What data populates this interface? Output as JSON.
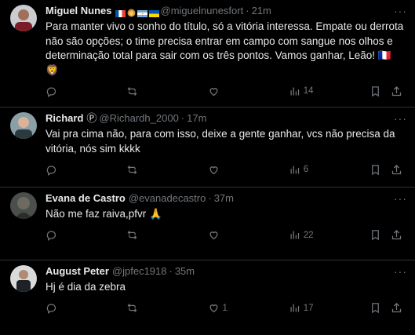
{
  "tweets": [
    {
      "name": "Miguel Nunes",
      "handle": "@miguelnunesfort",
      "time": "21m",
      "text": "Para manter vivo o sonho do título, só a vitória interessa. Empate ou derrota não são opções; o time precisa entrar em campo com sangue nos olhos e determinação total para sair com os três pontos. Vamos ganhar, Leão! 🇫🇷 🦁",
      "replies": "",
      "retweets": "",
      "likes": "",
      "views": "14"
    },
    {
      "name": "Richard",
      "name_suffix": "Ⓟ",
      "handle": "@Richardh_2000",
      "time": "17m",
      "text": "Vai pra cima não, para com isso, deixe a gente ganhar, vcs não precisa da vitória, nós sim kkkk",
      "replies": "",
      "retweets": "",
      "likes": "",
      "views": "6"
    },
    {
      "name": "Evana de Castro",
      "handle": "@evanadecastro",
      "time": "37m",
      "text": "Não me faz raiva,pfvr 🙏",
      "replies": "",
      "retweets": "",
      "likes": "",
      "views": "22"
    },
    {
      "name": "August Peter",
      "handle": "@jpfec1918",
      "time": "35m",
      "text": "Hj é dia da zebra",
      "replies": "",
      "retweets": "",
      "likes": "1",
      "views": "17"
    }
  ],
  "separator": "·",
  "colors": {
    "background": "#000000",
    "text": "#e7e9ea",
    "muted": "#71767b",
    "border": "#2f3336"
  }
}
